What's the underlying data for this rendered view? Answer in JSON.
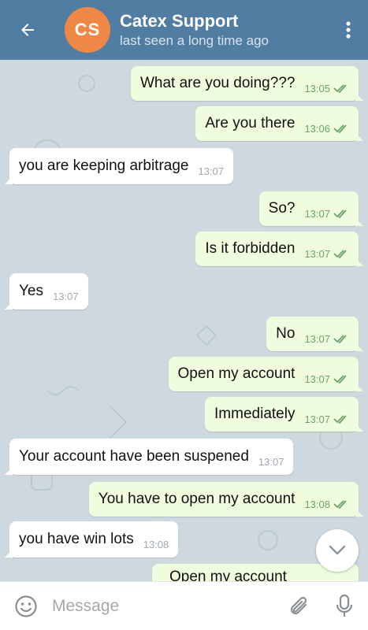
{
  "header": {
    "avatar_initials": "CS",
    "title": "Catex Support",
    "status": "last seen a long time ago",
    "color": "#517da2",
    "avatar_color": "#f08845",
    "back_icon": "arrow-left-icon",
    "menu_icon": "more-vertical-icon"
  },
  "messages": [
    {
      "dir": "out",
      "text": "What are you doing???",
      "time": "13:05",
      "read": true
    },
    {
      "dir": "out",
      "text": "Are you there",
      "time": "13:06",
      "read": true
    },
    {
      "dir": "in",
      "text": "you are keeping arbitrage",
      "time": "13:07"
    },
    {
      "dir": "out",
      "text": "So?",
      "time": "13:07",
      "read": true
    },
    {
      "dir": "out",
      "text": "Is it forbidden",
      "time": "13:07",
      "read": true
    },
    {
      "dir": "in",
      "text": "Yes",
      "time": "13:07"
    },
    {
      "dir": "out",
      "text": "No",
      "time": "13:07",
      "read": true
    },
    {
      "dir": "out",
      "text": "Open my account",
      "time": "13:07",
      "read": true
    },
    {
      "dir": "out",
      "text": "Immediately",
      "time": "13:07",
      "read": true
    },
    {
      "dir": "in",
      "text": "Your account have been suspened",
      "time": "13:07"
    },
    {
      "dir": "out",
      "text": "You have to open my account",
      "time": "13:08",
      "read": true
    },
    {
      "dir": "in",
      "text": "you have win lots",
      "time": "13:08"
    },
    {
      "dir": "out",
      "text": "Open my account",
      "time": "",
      "read": false,
      "partial": true
    }
  ],
  "scroll_down_icon": "chevron-down-icon",
  "input": {
    "placeholder": "Message",
    "value": "",
    "emoji_icon": "smile-icon",
    "attach_icon": "paperclip-icon",
    "mic_icon": "microphone-icon"
  },
  "colors": {
    "outgoing_bubble": "#effdde",
    "incoming_bubble": "#ffffff",
    "chat_background": "#cdd8df",
    "read_ticks": "#6ba36a"
  }
}
